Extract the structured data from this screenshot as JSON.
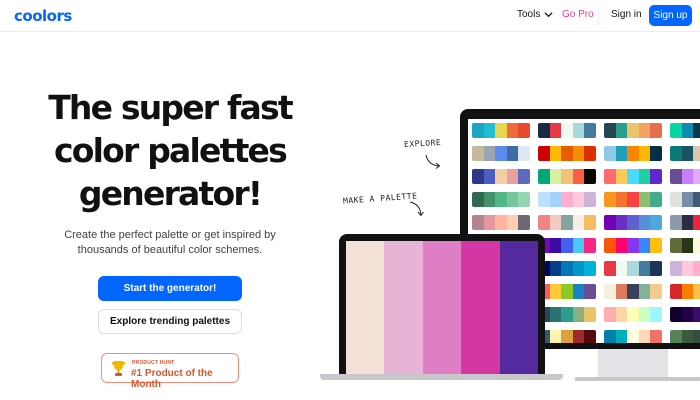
{
  "nav": {
    "logo": "coolors",
    "tools": "Tools",
    "gopro": "Go Pro",
    "signin": "Sign in",
    "signup": "Sign up"
  },
  "hero": {
    "title_lines": [
      "The super fast",
      "color palettes",
      "generator!"
    ],
    "subtitle_lines": [
      "Create the perfect palette or get inspired by",
      "thousands of beautiful color schemes."
    ],
    "primary_button": "Start the generator!",
    "secondary_button": "Explore trending palettes",
    "badge_small": "PRODUCT HUNT",
    "badge_big": "#1 Product of the Month"
  },
  "illustration": {
    "explore_label": "EXPLORE",
    "make_label": "MAKE A PALETTE",
    "laptop_palette": [
      "#f3e1d8",
      "#e8b4d6",
      "#de7ec4",
      "#d237a4",
      "#552a9e"
    ],
    "monitor_palettes": [
      [
        [
          "#1aa6c0",
          "#21bdd0",
          "#e8d64c",
          "#ef6b3b",
          "#e84a2f"
        ],
        [
          "#1c2b45",
          "#e63946",
          "#f1faee",
          "#a8dadc",
          "#457b9d"
        ],
        [
          "#264653",
          "#2a9d8f",
          "#e9c46a",
          "#f4a261",
          "#e76f51"
        ],
        [
          "#06d6a0",
          "#118ab2",
          "#073b4c",
          "#ffd166",
          "#ef476f"
        ]
      ],
      [
        [
          "#c9b99b",
          "#9aa5b1",
          "#5b8def",
          "#3a6ea5",
          "#dfe7f2"
        ],
        [
          "#d00000",
          "#ffba08",
          "#e85d04",
          "#f48c06",
          "#dc2f02"
        ],
        [
          "#8ecae6",
          "#219ebc",
          "#fb8500",
          "#ffb703",
          "#023047"
        ],
        [
          "#0b7a75",
          "#19535f",
          "#d7c9aa",
          "#7b2d26",
          "#f0f3f5"
        ]
      ],
      [
        [
          "#2e3a87",
          "#4a5fc1",
          "#f2d0a4",
          "#e9a0a0",
          "#5c6bc0"
        ],
        [
          "#00a878",
          "#d8f1a0",
          "#f3c178",
          "#fe5e41",
          "#0b0500"
        ],
        [
          "#ff6b6b",
          "#feca57",
          "#48dbfb",
          "#1dd1a1",
          "#5f27cd"
        ],
        [
          "#6a4c93",
          "#c77dff",
          "#e0aaff",
          "#9d4edd",
          "#3c096c"
        ]
      ],
      [
        [
          "#2d6a4f",
          "#40916c",
          "#52b788",
          "#74c69d",
          "#95d5b2"
        ],
        [
          "#bde0fe",
          "#a2d2ff",
          "#ffafcc",
          "#ffc8dd",
          "#cdb4db"
        ],
        [
          "#f8961e",
          "#f3722c",
          "#f94144",
          "#90be6d",
          "#43aa8b"
        ],
        [
          "#e0e1dd",
          "#778da9",
          "#415a77",
          "#1b263b",
          "#0d1b2a"
        ]
      ],
      [
        [
          "#b5838d",
          "#e5989b",
          "#ffb4a2",
          "#ffcdb2",
          "#6d6875"
        ],
        [
          "#f28482",
          "#f5cac3",
          "#84a59d",
          "#f7ede2",
          "#f6bd60"
        ],
        [
          "#7400b8",
          "#6930c3",
          "#5e60ce",
          "#5390d9",
          "#4ea8de"
        ],
        [
          "#8d99ae",
          "#2b2d42",
          "#ef233c",
          "#d90429",
          "#edf2f4"
        ]
      ],
      [
        [
          "#ff70a6",
          "#ff9770",
          "#ffd670",
          "#e9ff70",
          "#70d6ff"
        ],
        [
          "#7209b7",
          "#3a0ca3",
          "#4361ee",
          "#4cc9f0",
          "#f72585"
        ],
        [
          "#fb5607",
          "#ff006e",
          "#8338ec",
          "#3a86ff",
          "#ffbe0b"
        ],
        [
          "#606c38",
          "#283618",
          "#fefae0",
          "#dda15e",
          "#bc6c25"
        ]
      ],
      [
        [
          "#ef476f",
          "#ffd166",
          "#06d6a0",
          "#118ab2",
          "#073b4c"
        ],
        [
          "#03045e",
          "#023e8a",
          "#0077b6",
          "#0096c7",
          "#00b4d8"
        ],
        [
          "#e63946",
          "#f1faee",
          "#a8dadc",
          "#457b9d",
          "#1d3557"
        ],
        [
          "#cdb4db",
          "#ffc8dd",
          "#ffafcc",
          "#bde0fe",
          "#a2d2ff"
        ]
      ],
      [
        [
          "#5e548e",
          "#9f86c0",
          "#be95c4",
          "#e0b1cb",
          "#231942"
        ],
        [
          "#ff595e",
          "#ffca3a",
          "#8ac926",
          "#1982c4",
          "#6a4c93"
        ],
        [
          "#f4f1de",
          "#e07a5f",
          "#3d405b",
          "#81b29a",
          "#f2cc8f"
        ],
        [
          "#d62828",
          "#f77f00",
          "#fcbf49",
          "#eae2b7",
          "#003049"
        ]
      ],
      [
        [
          "#2ec4b6",
          "#cbf3f0",
          "#ffbf69",
          "#ff9f1c",
          "#ffffff"
        ],
        [
          "#264653",
          "#287271",
          "#2a9d8f",
          "#8ab17d",
          "#e9c46a"
        ],
        [
          "#ffadad",
          "#ffd6a5",
          "#fdffb6",
          "#caffbf",
          "#9bf6ff"
        ],
        [
          "#10002b",
          "#240046",
          "#3c096c",
          "#5a189a",
          "#7b2cbf"
        ]
      ],
      [
        [
          "#fb6f92",
          "#ff8fab",
          "#ffb3c6",
          "#ffc2d1",
          "#ffe5ec"
        ],
        [
          "#335c67",
          "#fff3b0",
          "#e09f3e",
          "#9e2a2b",
          "#540b0e"
        ],
        [
          "#0081a7",
          "#00afb9",
          "#fdfcdc",
          "#fed9b7",
          "#f07167"
        ],
        [
          "#588157",
          "#3a5a40",
          "#344e41",
          "#a3b18a",
          "#dad7cd"
        ]
      ]
    ]
  }
}
